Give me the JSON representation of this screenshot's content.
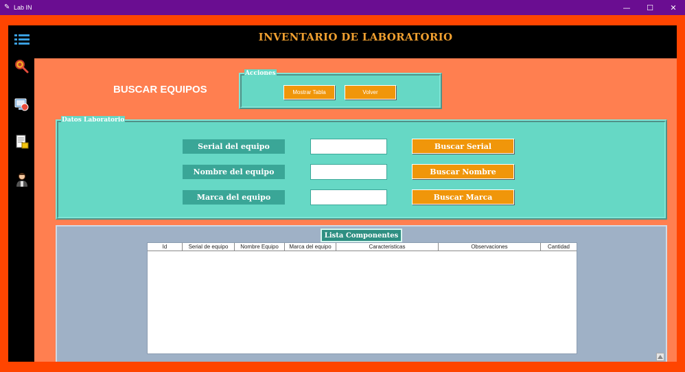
{
  "window": {
    "title": "Lab IN",
    "icon": "feather-icon",
    "controls": {
      "minimize": "—",
      "maximize": "☐",
      "close": "✕"
    }
  },
  "sidebar": {
    "items": [
      {
        "name": "list-menu-icon"
      },
      {
        "name": "search-magnifier-icon"
      },
      {
        "name": "monitor-search-icon"
      },
      {
        "name": "document-inventory-icon"
      },
      {
        "name": "user-technician-icon"
      }
    ]
  },
  "header": {
    "title": "INVENTARIO DE LABORATORIO"
  },
  "page": {
    "heading": "BUSCAR EQUIPOS"
  },
  "acciones": {
    "legend": "Acciones",
    "show_table_label": "Mostrar Tabla",
    "back_label": "Volver"
  },
  "datos": {
    "legend": "Datos Laboratorio",
    "serial_label": "Serial del equipo",
    "name_label": "Nombre del equipo",
    "brand_label": "Marca del equipo",
    "serial_value": "",
    "name_value": "",
    "brand_value": "",
    "search_serial_label": "Buscar Serial",
    "search_name_label": "Buscar Nombre",
    "search_brand_label": "Buscar Marca"
  },
  "list": {
    "title": "Lista Componentes",
    "columns": [
      "Id",
      "Serial de equipo",
      "Nombre Equipo",
      "Marca del equipo",
      "Caracteristicas",
      "Observaciones",
      "Cantidad"
    ],
    "rows": []
  },
  "colors": {
    "titlebar": "#6a0d91",
    "frame": "#ff4500",
    "content": "#ff7f50",
    "panel": "#66d8c5",
    "label": "#3aa697",
    "button": "#f0960a",
    "header_text": "#f0a030",
    "list_panel": "#9fb1c6"
  }
}
